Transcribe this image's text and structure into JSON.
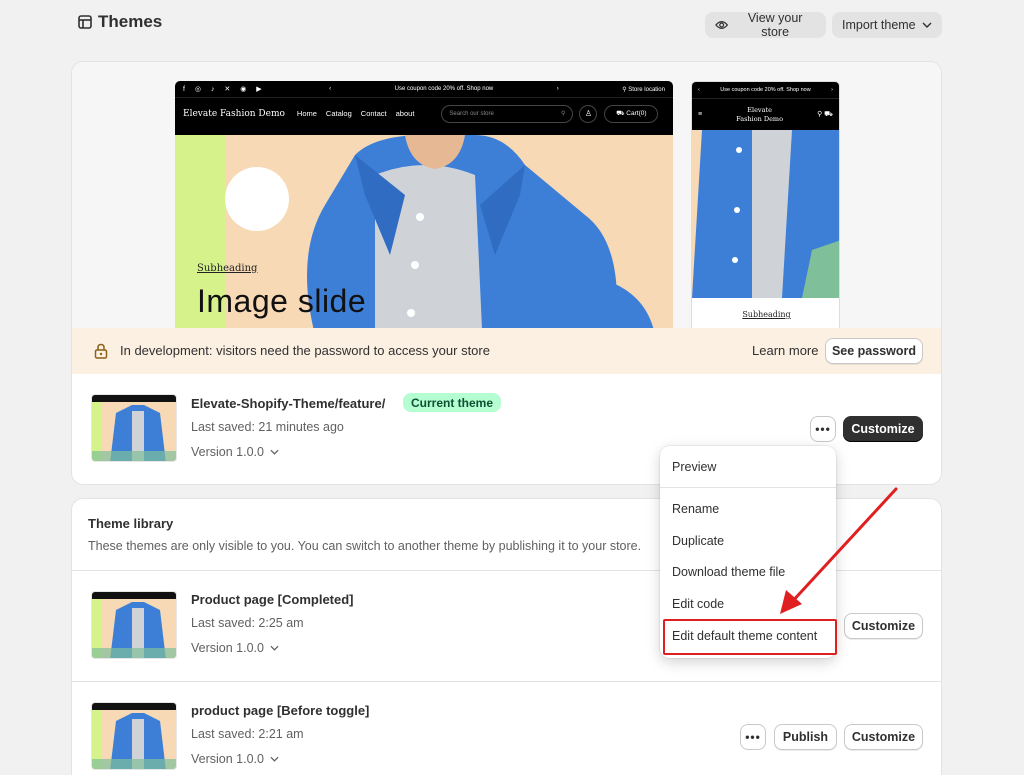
{
  "header": {
    "title": "Themes",
    "view_store_label": "View your store",
    "import_theme_label": "Import theme"
  },
  "preview": {
    "announcement": "Use coupon code 20% off. Shop now",
    "store_location": "Store location",
    "brand": "Elevate Fashion Demo",
    "nav": [
      "Home",
      "Catalog",
      "Contact",
      "about"
    ],
    "search_placeholder": "Search our store",
    "cart": "Cart(0)",
    "subheading": "Subheading",
    "slide_title": "Image slide",
    "mobile_brand": "Elevate Fashion Demo",
    "mobile_subheading": "Subheading"
  },
  "dev_banner": {
    "message": "In development: visitors need the password to access your store",
    "learn_more": "Learn more",
    "see_password": "See password"
  },
  "current_theme": {
    "name": "Elevate-Shopify-Theme/feature/",
    "badge": "Current theme",
    "last_saved": "Last saved: 21 minutes ago",
    "version": "Version 1.0.0",
    "customize": "Customize",
    "more": "•••"
  },
  "menu": {
    "items": [
      "Preview",
      "Rename",
      "Duplicate",
      "Download theme file",
      "Edit code",
      "Edit default theme content"
    ]
  },
  "library": {
    "title": "Theme library",
    "description": "These themes are only visible to you. You can switch to another theme by publishing it to your store.",
    "themes": [
      {
        "name": "Product page [Completed]",
        "last_saved": "Last saved: 2:25 am",
        "version": "Version 1.0.0",
        "customize": "Customize"
      },
      {
        "name": "product page [Before toggle]",
        "last_saved": "Last saved: 2:21 am",
        "version": "Version 1.0.0",
        "publish": "Publish",
        "customize": "Customize",
        "more": "•••"
      }
    ]
  },
  "colors": {
    "accent_dark": "#303030",
    "badge_bg": "#b4fed2",
    "banner_bg": "#fcf0e3",
    "annotation_red": "#e02020"
  },
  "icons": {
    "title_icon": "theme-icon",
    "eye": "eye-icon",
    "chevron": "chevron-down-icon",
    "lock": "lock-icon"
  }
}
